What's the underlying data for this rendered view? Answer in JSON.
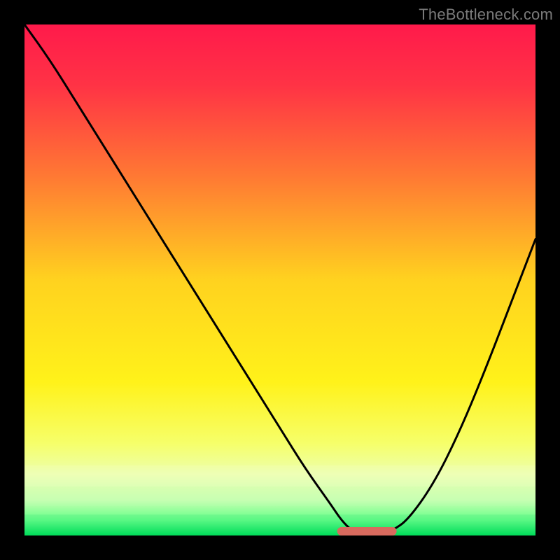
{
  "watermark": {
    "text": "TheBottleneck.com"
  },
  "chart_data": {
    "type": "line",
    "title": "",
    "xlabel": "",
    "ylabel": "",
    "xlim": [
      0,
      100
    ],
    "ylim": [
      0,
      100
    ],
    "x": [
      0,
      5,
      10,
      15,
      20,
      25,
      30,
      35,
      40,
      45,
      50,
      55,
      60,
      62,
      64,
      66,
      68,
      70,
      72,
      75,
      80,
      85,
      90,
      95,
      100
    ],
    "values": [
      100,
      93,
      85,
      77,
      69,
      61,
      53,
      45,
      37,
      29,
      21,
      13,
      6,
      3,
      1,
      0,
      0,
      0,
      1,
      3,
      10,
      20,
      32,
      45,
      58
    ],
    "optimal_range_x": [
      62,
      72
    ],
    "background_gradient": {
      "stops": [
        {
          "pos": 0.0,
          "color": "#ff1a4b"
        },
        {
          "pos": 0.12,
          "color": "#ff3345"
        },
        {
          "pos": 0.3,
          "color": "#ff7a33"
        },
        {
          "pos": 0.5,
          "color": "#ffd21f"
        },
        {
          "pos": 0.7,
          "color": "#fff21a"
        },
        {
          "pos": 0.82,
          "color": "#f6ff6a"
        },
        {
          "pos": 0.88,
          "color": "#ecffad"
        },
        {
          "pos": 0.93,
          "color": "#c9ffb0"
        },
        {
          "pos": 0.97,
          "color": "#66ff8a"
        },
        {
          "pos": 1.0,
          "color": "#00e05a"
        }
      ]
    },
    "marker_color": "#d86a5e",
    "curve_color": "#000000"
  }
}
